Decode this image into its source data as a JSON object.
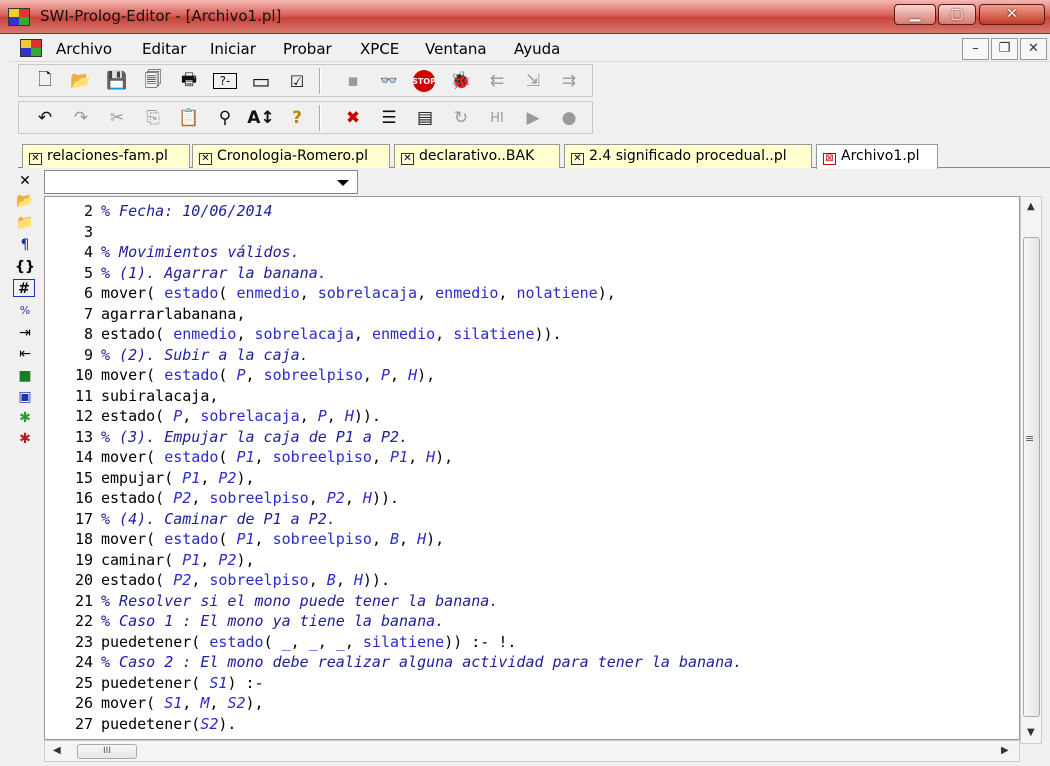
{
  "window": {
    "title": "SWI-Prolog-Editor - [Archivo1.pl]",
    "minimize_icon": "minimize-icon",
    "maximize_icon": "maximize-icon",
    "close_icon": "close-icon"
  },
  "menu": {
    "items": [
      "Archivo",
      "Editar",
      "Iniciar",
      "Probar",
      "XPCE",
      "Ventana",
      "Ayuda"
    ]
  },
  "tabs": [
    {
      "label": "relaciones-fam.pl",
      "active": false
    },
    {
      "label": "Cronologia-Romero.pl",
      "active": false
    },
    {
      "label": "declarativo..BAK",
      "active": false
    },
    {
      "label": "2.4 significado procedual..pl",
      "active": false
    },
    {
      "label": "Archivo1.pl",
      "active": true
    }
  ],
  "editor": {
    "dropdown_value": "",
    "lines": [
      {
        "n": "2",
        "tokens": [
          {
            "t": "% Fecha: 10/06/2014",
            "c": "cm"
          }
        ]
      },
      {
        "n": "3",
        "tokens": []
      },
      {
        "n": "4",
        "tokens": [
          {
            "t": "% Movimientos válidos.",
            "c": "cm"
          }
        ]
      },
      {
        "n": "5",
        "tokens": [
          {
            "t": "% (1). Agarrar la banana.",
            "c": "cm"
          }
        ]
      },
      {
        "n": "6",
        "tokens": [
          {
            "t": "mover( ",
            "c": "fn"
          },
          {
            "t": "estado",
            "c": "atm"
          },
          {
            "t": "( ",
            "c": "pl"
          },
          {
            "t": "enmedio",
            "c": "atm"
          },
          {
            "t": ", ",
            "c": "pl"
          },
          {
            "t": "sobrelacaja",
            "c": "atm"
          },
          {
            "t": ", ",
            "c": "pl"
          },
          {
            "t": "enmedio",
            "c": "atm"
          },
          {
            "t": ", ",
            "c": "pl"
          },
          {
            "t": "nolatiene",
            "c": "atm"
          },
          {
            "t": "),",
            "c": "pl"
          }
        ]
      },
      {
        "n": "7",
        "tokens": [
          {
            "t": "agarrarlabanana,",
            "c": "fn"
          }
        ]
      },
      {
        "n": "8",
        "tokens": [
          {
            "t": "estado( ",
            "c": "fn"
          },
          {
            "t": "enmedio",
            "c": "atm"
          },
          {
            "t": ", ",
            "c": "pl"
          },
          {
            "t": "sobrelacaja",
            "c": "atm"
          },
          {
            "t": ", ",
            "c": "pl"
          },
          {
            "t": "enmedio",
            "c": "atm"
          },
          {
            "t": ", ",
            "c": "pl"
          },
          {
            "t": "silatiene",
            "c": "atm"
          },
          {
            "t": ")).",
            "c": "pl"
          }
        ]
      },
      {
        "n": "9",
        "tokens": [
          {
            "t": "% (2). Subir a la caja.",
            "c": "cm"
          }
        ]
      },
      {
        "n": "10",
        "tokens": [
          {
            "t": "mover( ",
            "c": "fn"
          },
          {
            "t": "estado",
            "c": "atm"
          },
          {
            "t": "( ",
            "c": "pl"
          },
          {
            "t": "P",
            "c": "var"
          },
          {
            "t": ", ",
            "c": "pl"
          },
          {
            "t": "sobreelpiso",
            "c": "atm"
          },
          {
            "t": ", ",
            "c": "pl"
          },
          {
            "t": "P",
            "c": "var"
          },
          {
            "t": ", ",
            "c": "pl"
          },
          {
            "t": "H",
            "c": "var"
          },
          {
            "t": "),",
            "c": "pl"
          }
        ]
      },
      {
        "n": "11",
        "tokens": [
          {
            "t": "subiralacaja,",
            "c": "fn"
          }
        ]
      },
      {
        "n": "12",
        "tokens": [
          {
            "t": "estado( ",
            "c": "fn"
          },
          {
            "t": "P",
            "c": "var"
          },
          {
            "t": ", ",
            "c": "pl"
          },
          {
            "t": "sobrelacaja",
            "c": "atm"
          },
          {
            "t": ", ",
            "c": "pl"
          },
          {
            "t": "P",
            "c": "var"
          },
          {
            "t": ", ",
            "c": "pl"
          },
          {
            "t": "H",
            "c": "var"
          },
          {
            "t": ")).",
            "c": "pl"
          }
        ]
      },
      {
        "n": "13",
        "tokens": [
          {
            "t": "% (3). Empujar la caja de P1 a P2.",
            "c": "cm"
          }
        ]
      },
      {
        "n": "14",
        "tokens": [
          {
            "t": "mover( ",
            "c": "fn"
          },
          {
            "t": "estado",
            "c": "atm"
          },
          {
            "t": "( ",
            "c": "pl"
          },
          {
            "t": "P1",
            "c": "var"
          },
          {
            "t": ", ",
            "c": "pl"
          },
          {
            "t": "sobreelpiso",
            "c": "atm"
          },
          {
            "t": ", ",
            "c": "pl"
          },
          {
            "t": "P1",
            "c": "var"
          },
          {
            "t": ", ",
            "c": "pl"
          },
          {
            "t": "H",
            "c": "var"
          },
          {
            "t": "),",
            "c": "pl"
          }
        ]
      },
      {
        "n": "15",
        "tokens": [
          {
            "t": "empujar( ",
            "c": "fn"
          },
          {
            "t": "P1",
            "c": "var"
          },
          {
            "t": ", ",
            "c": "pl"
          },
          {
            "t": "P2",
            "c": "var"
          },
          {
            "t": "),",
            "c": "pl"
          }
        ]
      },
      {
        "n": "16",
        "tokens": [
          {
            "t": "estado( ",
            "c": "fn"
          },
          {
            "t": "P2",
            "c": "var"
          },
          {
            "t": ", ",
            "c": "pl"
          },
          {
            "t": "sobreelpiso",
            "c": "atm"
          },
          {
            "t": ", ",
            "c": "pl"
          },
          {
            "t": "P2",
            "c": "var"
          },
          {
            "t": ", ",
            "c": "pl"
          },
          {
            "t": "H",
            "c": "var"
          },
          {
            "t": ")).",
            "c": "pl"
          }
        ]
      },
      {
        "n": "17",
        "tokens": [
          {
            "t": "% (4). Caminar de P1 a P2.",
            "c": "cm"
          }
        ]
      },
      {
        "n": "18",
        "tokens": [
          {
            "t": "mover( ",
            "c": "fn"
          },
          {
            "t": "estado",
            "c": "atm"
          },
          {
            "t": "( ",
            "c": "pl"
          },
          {
            "t": "P1",
            "c": "var"
          },
          {
            "t": ", ",
            "c": "pl"
          },
          {
            "t": "sobreelpiso",
            "c": "atm"
          },
          {
            "t": ", ",
            "c": "pl"
          },
          {
            "t": "B",
            "c": "var"
          },
          {
            "t": ", ",
            "c": "pl"
          },
          {
            "t": "H",
            "c": "var"
          },
          {
            "t": "),",
            "c": "pl"
          }
        ]
      },
      {
        "n": "19",
        "tokens": [
          {
            "t": "caminar( ",
            "c": "fn"
          },
          {
            "t": "P1",
            "c": "var"
          },
          {
            "t": ", ",
            "c": "pl"
          },
          {
            "t": "P2",
            "c": "var"
          },
          {
            "t": "),",
            "c": "pl"
          }
        ]
      },
      {
        "n": "20",
        "tokens": [
          {
            "t": "estado( ",
            "c": "fn"
          },
          {
            "t": "P2",
            "c": "var"
          },
          {
            "t": ", ",
            "c": "pl"
          },
          {
            "t": "sobreelpiso",
            "c": "atm"
          },
          {
            "t": ", ",
            "c": "pl"
          },
          {
            "t": "B",
            "c": "var"
          },
          {
            "t": ", ",
            "c": "pl"
          },
          {
            "t": "H",
            "c": "var"
          },
          {
            "t": ")).",
            "c": "pl"
          }
        ]
      },
      {
        "n": "21",
        "tokens": [
          {
            "t": "% Resolver si el mono puede tener la banana.",
            "c": "cm"
          }
        ]
      },
      {
        "n": "22",
        "tokens": [
          {
            "t": "% Caso 1 : El mono ya tiene la banana.",
            "c": "cm"
          }
        ]
      },
      {
        "n": "23",
        "tokens": [
          {
            "t": "puedetener( ",
            "c": "fn"
          },
          {
            "t": "estado",
            "c": "atm"
          },
          {
            "t": "( ",
            "c": "pl"
          },
          {
            "t": "_",
            "c": "var"
          },
          {
            "t": ", ",
            "c": "pl"
          },
          {
            "t": "_",
            "c": "var"
          },
          {
            "t": ", ",
            "c": "pl"
          },
          {
            "t": "_",
            "c": "var"
          },
          {
            "t": ", ",
            "c": "pl"
          },
          {
            "t": "silatiene",
            "c": "atm"
          },
          {
            "t": ")) :- !.",
            "c": "pl"
          }
        ]
      },
      {
        "n": "24",
        "tokens": [
          {
            "t": "% Caso 2 : El mono debe realizar alguna actividad para tener la banana.",
            "c": "cm"
          }
        ]
      },
      {
        "n": "25",
        "tokens": [
          {
            "t": "puedetener( ",
            "c": "fn"
          },
          {
            "t": "S1",
            "c": "var"
          },
          {
            "t": ") :-",
            "c": "pl"
          }
        ]
      },
      {
        "n": "26",
        "tokens": [
          {
            "t": "mover( ",
            "c": "fn"
          },
          {
            "t": "S1",
            "c": "var"
          },
          {
            "t": ", ",
            "c": "pl"
          },
          {
            "t": "M",
            "c": "var"
          },
          {
            "t": ", ",
            "c": "pl"
          },
          {
            "t": "S2",
            "c": "var"
          },
          {
            "t": "),",
            "c": "pl"
          }
        ]
      },
      {
        "n": "27",
        "tokens": [
          {
            "t": "puedetener(",
            "c": "fn"
          },
          {
            "t": "S2",
            "c": "var"
          },
          {
            "t": ").",
            "c": "pl"
          }
        ]
      }
    ]
  },
  "toolbar1_icons": [
    "new-file-icon",
    "open-folder-icon",
    "save-icon",
    "save-all-icon",
    "print-icon",
    "console-icon",
    "window-icon",
    "checklist-icon",
    "disk-icon",
    "glasses-icon",
    "stop-icon",
    "debug-bug-icon",
    "step-back-icon",
    "step-into-icon",
    "step-out-icon"
  ],
  "toolbar2_icons": [
    "undo-icon",
    "redo-icon",
    "cut-icon",
    "copy-icon",
    "paste-icon",
    "find-icon",
    "replace-icon",
    "help-icon",
    "consult-icon",
    "list-icon",
    "list-all-icon",
    "refresh-icon",
    "hit-icon",
    "run-icon",
    "record-icon"
  ],
  "scrollbar": {
    "h_thumb_glyph": "III",
    "v_grip_glyph": "≡"
  },
  "colors": {
    "comment": "#1d1d9e",
    "atom": "#2a2ad0",
    "tab_inactive": "#ffffcf",
    "titlebar": "#d9635a"
  }
}
